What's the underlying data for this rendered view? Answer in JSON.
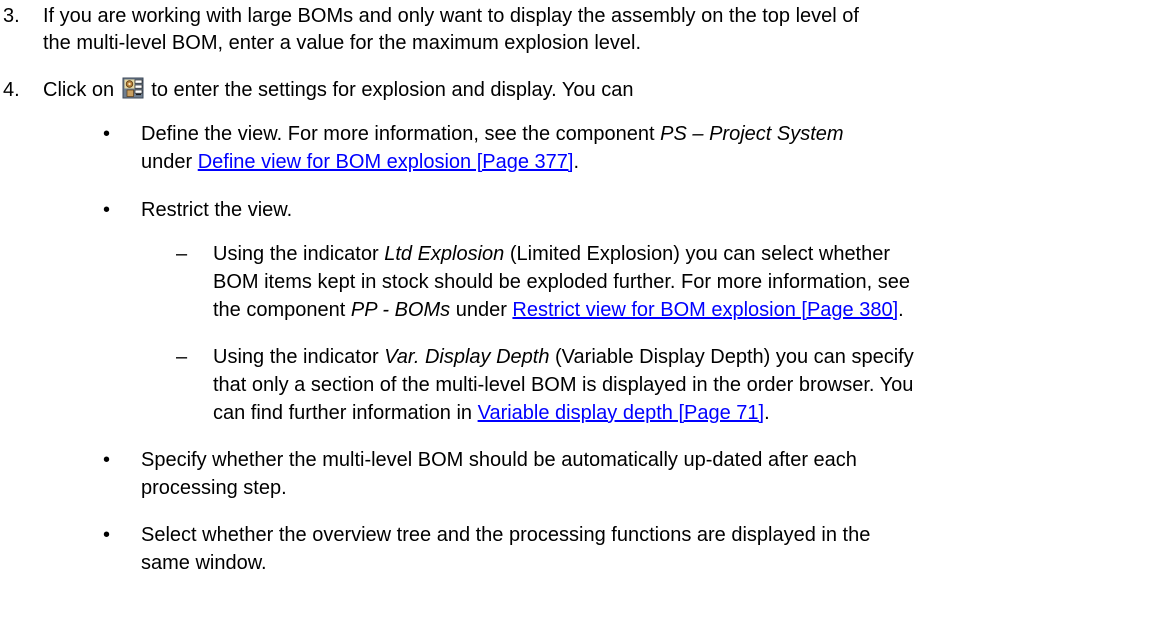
{
  "step3": {
    "number": "3.",
    "line1": "If you are working with large BOMs and only want to display the assembly on the top level of",
    "line2": "the multi-level BOM, enter a value for the maximum explosion level."
  },
  "step4": {
    "number": "4.",
    "before_icon": "Click on",
    "icon": "settings-icon",
    "after_icon": "to enter the settings for explosion and display. You can"
  },
  "bullets": {
    "dot": "•",
    "define_view": {
      "line1_a": "Define the view. For more information, see the component ",
      "line1_em": "PS – Project System",
      "line2_a": "under ",
      "link": "Define view for BOM explosion [Page 377]",
      "line2_b": "."
    },
    "restrict_view": {
      "text": "Restrict the view."
    },
    "auto_update": {
      "line1": "Specify whether the multi-level BOM should be automatically up-dated after each",
      "line2": "processing step."
    },
    "same_window": {
      "line1": "Select whether the overview tree and the processing functions are displayed in the",
      "line2": "same window."
    }
  },
  "dashes": {
    "dash": "–",
    "ltd_explosion": {
      "line1_a": "Using the indicator ",
      "line1_em": "Ltd Explosion",
      "line1_b": " (Limited Explosion) you can select whether",
      "line2": "BOM items kept in stock should be exploded further. For more information, see",
      "line3_a": "the component ",
      "line3_em": "PP - BOMs",
      "line3_b": " under ",
      "link": "Restrict view for BOM explosion [Page 380]",
      "line3_c": "."
    },
    "var_display": {
      "line1_a": "Using the indicator ",
      "line1_em": "Var. Display Depth",
      "line1_b": " (Variable Display Depth) you can specify",
      "line2": "that only a section of the multi-level BOM is displayed in the order browser. You",
      "line3_a": "can find further information in ",
      "link": "Variable display depth [Page 71]",
      "line3_b": "."
    }
  },
  "colors": {
    "text": "#000000",
    "link": "#0000ff"
  }
}
